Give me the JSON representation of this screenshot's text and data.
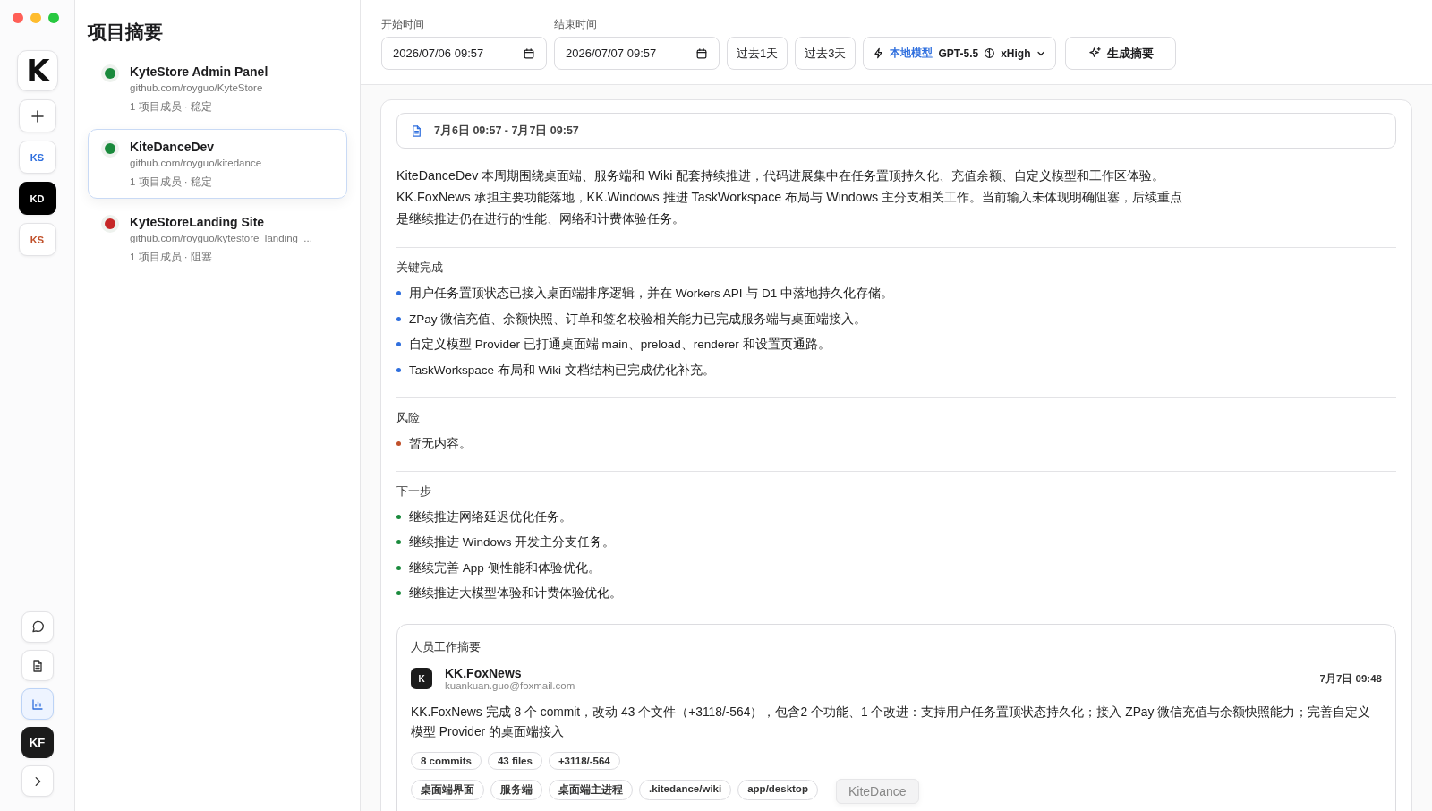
{
  "rail": {
    "items": [
      {
        "kind": "logo",
        "label": "K"
      },
      {
        "kind": "add",
        "selected": false
      },
      {
        "kind": "project",
        "label": "KS",
        "color": "#2f6fde",
        "selected": false
      },
      {
        "kind": "project",
        "label": "KD",
        "selected": true
      },
      {
        "kind": "project",
        "label": "KS",
        "color": "#c0502a",
        "selected": false
      }
    ],
    "bottom": [
      {
        "kind": "chat",
        "selected": false
      },
      {
        "kind": "document",
        "selected": false
      },
      {
        "kind": "chart",
        "selected": true
      },
      {
        "kind": "avatar",
        "label": "KF"
      },
      {
        "kind": "expand"
      }
    ]
  },
  "sidebar": {
    "title": "项目摘要",
    "projects": [
      {
        "name": "KyteStore Admin Panel",
        "repo": "github.com/royguo/KyteStore",
        "meta": "1 项目成员 · 稳定",
        "color": "#1a8a3c",
        "selected": false
      },
      {
        "name": "KiteDanceDev",
        "repo": "github.com/royguo/kitedance",
        "meta": "1 项目成员 · 稳定",
        "color": "#1a8a3c",
        "selected": true
      },
      {
        "name": "KyteStoreLanding Site",
        "repo": "github.com/royguo/kytestore_landing_...",
        "meta": "1 项目成员 · 阻塞",
        "color": "#c62828",
        "selected": false
      }
    ]
  },
  "toolbar": {
    "start": {
      "label": "开始时间",
      "value": "2026/07/06 09:57"
    },
    "end": {
      "label": "结束时间",
      "value": "2026/07/07 09:57"
    },
    "quick_ranges": [
      {
        "label": "过去1天"
      },
      {
        "label": "过去3天"
      }
    ],
    "model": {
      "source": "本地模型",
      "name": "GPT-5.5",
      "effort": "xHigh"
    },
    "generate": {
      "label": "生成摘要"
    }
  },
  "summary": {
    "range": "7月6日 09:57 - 7月7日 09:57",
    "overview_lines": [
      "KiteDanceDev 本周期围绕桌面端、服务端和 Wiki 配套持续推进，代码进展集中在任务置顶持久化、充值余额、自定义模型和工作区体验。",
      "KK.FoxNews 承担主要功能落地，KK.Windows 推进 TaskWorkspace 布局与 Windows 主分支相关工作。当前输入未体现明确阻塞，后续重点",
      "是继续推进仍在进行的性能、网络和计费体验任务。"
    ],
    "sections": [
      {
        "title": "关键完成",
        "color": "#2f6fde",
        "items": [
          "用户任务置顶状态已接入桌面端排序逻辑，并在 Workers API 与 D1 中落地持久化存储。",
          "ZPay 微信充值、余额快照、订单和签名校验相关能力已完成服务端与桌面端接入。",
          "自定义模型 Provider 已打通桌面端 main、preload、renderer 和设置页通路。",
          "TaskWorkspace 布局和 Wiki 文档结构已完成优化补充。"
        ]
      },
      {
        "title": "风险",
        "color": "#c0502a",
        "items": [
          "暂无内容。"
        ]
      },
      {
        "title": "下一步",
        "color": "#1a8a3c",
        "items": [
          "继续推进网络延迟优化任务。",
          "继续推进 Windows 开发主分支任务。",
          "继续完善 App 侧性能和体验优化。",
          "继续推进大模型体验和计费体验优化。"
        ]
      }
    ],
    "people": {
      "title": "人员工作摘要",
      "members": [
        {
          "initial": "K",
          "name": "KK.FoxNews",
          "email": "kuankuan.guo@foxmail.com",
          "time": "7月7日 09:48",
          "text": "KK.FoxNews 完成 8 个 commit，改动 43 个文件（+3118/-564），包含2 个功能、1 个改进：支持用户任务置顶状态持久化；接入 ZPay 微信充值与余额快照能力；完善自定义模型 Provider 的桌面端接入",
          "stats": [
            "8 commits",
            "43 files",
            "+3118/-564"
          ],
          "tags": [
            "桌面端界面",
            "服务端",
            "桌面端主进程",
            ".kitedance/wiki",
            "app/desktop"
          ]
        }
      ]
    },
    "tooltip": "KiteDance"
  }
}
